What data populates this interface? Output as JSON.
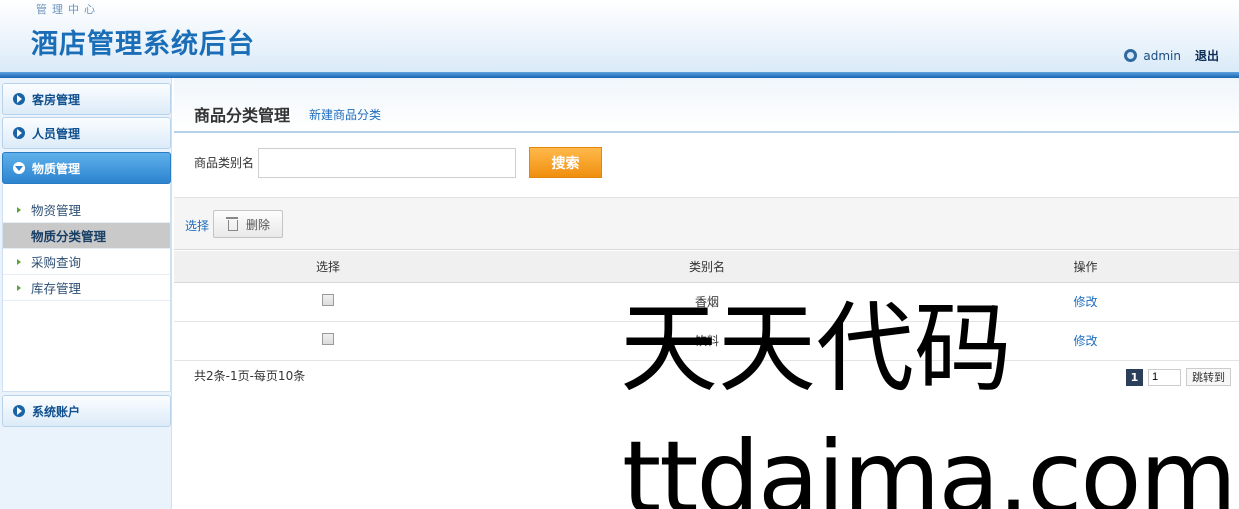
{
  "header": {
    "subtitle": "管理中心",
    "title": "酒店管理系统后台",
    "username": "admin",
    "logout_label": "退出"
  },
  "sidebar": {
    "menus": [
      {
        "label": "客房管理"
      },
      {
        "label": "人员管理"
      },
      {
        "label": "物质管理"
      },
      {
        "label": "系统账户"
      }
    ],
    "submenu": [
      {
        "label": "物资管理"
      },
      {
        "label": "物质分类管理"
      },
      {
        "label": "采购查询"
      },
      {
        "label": "库存管理"
      }
    ]
  },
  "main": {
    "page_title": "商品分类管理",
    "new_link": "新建商品分类",
    "search": {
      "label": "商品类别名",
      "value": "",
      "button": "搜索"
    },
    "toolbar": {
      "select_label": "选择",
      "delete_label": "删除"
    },
    "table": {
      "headers": [
        "选择",
        "类别名",
        "操作"
      ],
      "rows": [
        {
          "name": "香烟",
          "action": "修改"
        },
        {
          "name": "饮料",
          "action": "修改"
        }
      ]
    },
    "pager": {
      "info": "共2条-1页-每页10条",
      "current_page": "1",
      "input_value": "1",
      "jump_label": "跳转到"
    }
  },
  "watermark": {
    "line1": "天天代码",
    "line2": "ttdaima.com"
  }
}
